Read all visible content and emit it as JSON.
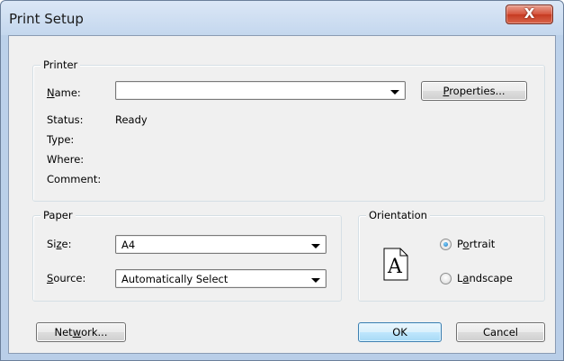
{
  "window": {
    "title": "Print Setup",
    "close_glyph": "X"
  },
  "printer": {
    "group_label": "Printer",
    "name_label_prefix": "",
    "name_label_accel": "N",
    "name_label_rest": "ame:",
    "name_value": "",
    "properties_accel": "P",
    "properties_rest": "roperties...",
    "status_label": "Status:",
    "status_value": "Ready",
    "type_label": "Type:",
    "where_label": "Where:",
    "comment_label": "Comment:"
  },
  "paper": {
    "group_label": "Paper",
    "size_prefix": "Si",
    "size_accel": "z",
    "size_rest": "e:",
    "size_value": "A4",
    "source_prefix": "",
    "source_accel": "S",
    "source_rest": "ource:",
    "source_value": "Automatically Select"
  },
  "orientation": {
    "group_label": "Orientation",
    "page_letter": "A",
    "portrait_prefix": "P",
    "portrait_accel": "o",
    "portrait_rest": "rtrait",
    "portrait_selected": true,
    "landscape_prefix": "L",
    "landscape_accel": "a",
    "landscape_rest": "ndscape",
    "landscape_selected": false
  },
  "buttons": {
    "network_prefix": "Net",
    "network_accel": "w",
    "network_rest": "ork...",
    "ok": "OK",
    "cancel": "Cancel"
  }
}
